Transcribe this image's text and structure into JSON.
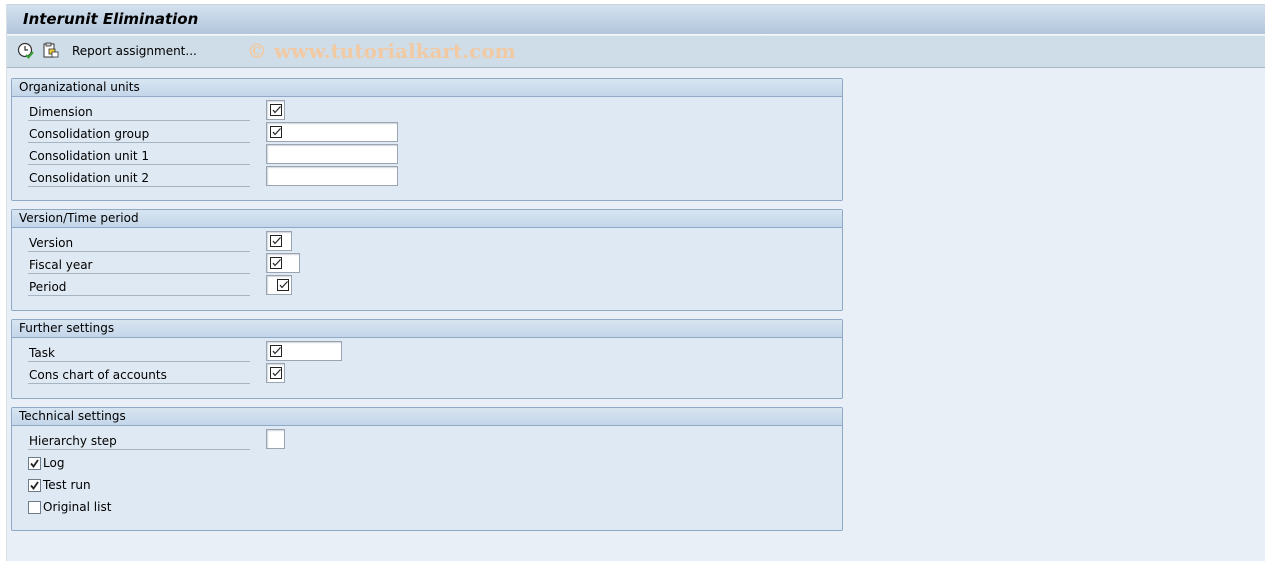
{
  "window": {
    "title": "Interunit Elimination"
  },
  "toolbar": {
    "icons": [
      "execute-background-icon",
      "report-assignment-icon"
    ],
    "report_assignment_label": "Report assignment...",
    "watermark": "© www.tutorialkart.com"
  },
  "groups": {
    "org_units": {
      "title": "Organizational units",
      "rows": [
        {
          "label": "Dimension",
          "value": "",
          "required": true
        },
        {
          "label": "Consolidation group",
          "value": "",
          "required": true
        },
        {
          "label": "Consolidation unit 1",
          "value": "",
          "required": false
        },
        {
          "label": "Consolidation unit 2",
          "value": "",
          "required": false
        }
      ]
    },
    "version_time": {
      "title": "Version/Time period",
      "rows": [
        {
          "label": "Version",
          "value": "",
          "required": true
        },
        {
          "label": "Fiscal year",
          "value": "",
          "required": true
        },
        {
          "label": "Period",
          "value": "",
          "required": true
        }
      ]
    },
    "further": {
      "title": "Further settings",
      "rows": [
        {
          "label": "Task",
          "value": "",
          "required": true
        },
        {
          "label": "Cons chart of accounts",
          "value": "",
          "required": true
        }
      ]
    },
    "technical": {
      "title": "Technical settings",
      "rows": [
        {
          "label": "Hierarchy step",
          "value": "",
          "required": false
        }
      ],
      "checkboxes": [
        {
          "label": "Log",
          "checked": true
        },
        {
          "label": "Test run",
          "checked": true
        },
        {
          "label": "Original list",
          "checked": false
        }
      ]
    }
  }
}
